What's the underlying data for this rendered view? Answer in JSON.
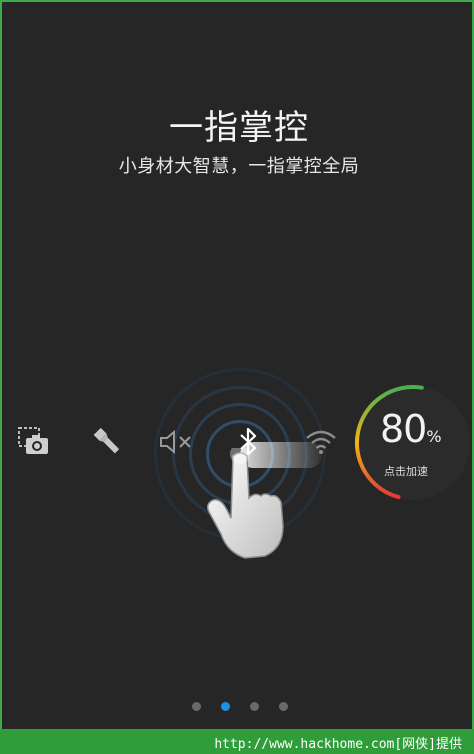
{
  "intro": {
    "title": "一指掌控",
    "subtitle": "小身材大智慧，一指掌控全局"
  },
  "toolbar": {
    "items": [
      {
        "name": "screenshot",
        "icon": "screenshot-icon"
      },
      {
        "name": "flashlight",
        "icon": "flashlight-icon"
      },
      {
        "name": "mute",
        "icon": "mute-icon"
      },
      {
        "name": "bluetooth",
        "icon": "bluetooth-icon"
      },
      {
        "name": "wifi",
        "icon": "wifi-icon"
      }
    ]
  },
  "speedup": {
    "percent": "80",
    "percent_sign": "%",
    "label": "点击加速",
    "level": 0.8,
    "colors": {
      "start": "#e53935",
      "mid": "#f2b51b",
      "end": "#4caf50"
    }
  },
  "pager": {
    "count": 4,
    "active_index": 1,
    "active_color": "#1e90e6"
  },
  "footer": {
    "text": "http://www.hackhome.com[网侠]提供"
  }
}
